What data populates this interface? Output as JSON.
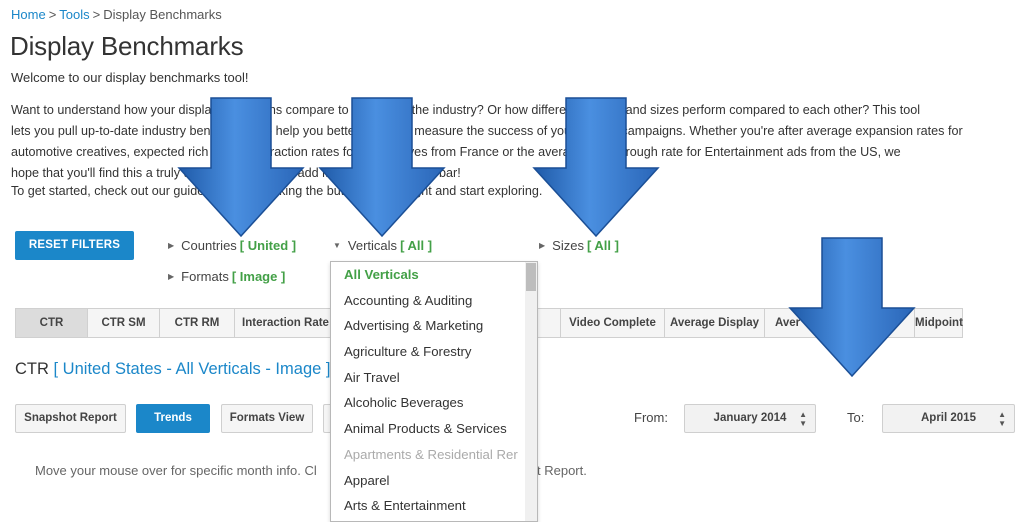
{
  "breadcrumb": {
    "home": "Home",
    "tools": "Tools",
    "current": "Display Benchmarks",
    "separator": ">"
  },
  "page": {
    "title": "Display Benchmarks",
    "welcome": "Welcome to our display benchmarks tool!",
    "intro_lines": [
      "Want to understand how your display campaigns compare to the rest of the industry? Or how different formats and sizes perform compared to each other? This tool",
      "lets you pull up-to-date industry benchmarks to help you better plan and measure the success of your display campaigns. Whether you're after average expansion rates for",
      "automotive creatives, expected rich media interaction rates for all creatives from France or the average click through rate for Entertainment ads from the US, we",
      "hope that you'll find this a truly useful resource and add it to your bookmarks bar!"
    ],
    "get_started": "To get started, check out our guide below by clicking the button to your right and start exploring."
  },
  "filters": {
    "reset_label": "RESET FILTERS",
    "countries": {
      "label": "Countries",
      "value": "[ United ]"
    },
    "verticals": {
      "label": "Verticals",
      "value": "[ All ]"
    },
    "sizes": {
      "label": "Sizes",
      "value": "[ All ]"
    },
    "formats": {
      "label": "Formats",
      "value": "[ Image ]"
    }
  },
  "metric_tabs": [
    {
      "label": "CTR",
      "active": true
    },
    {
      "label": "CTR SM"
    },
    {
      "label": "CTR RM"
    },
    {
      "label": "Interaction Rate"
    },
    {
      "label": ""
    },
    {
      "label": "Video Complete"
    },
    {
      "label": "Average Display"
    },
    {
      "label": "Aver"
    },
    {
      "label": ""
    },
    {
      "label": "Midpoint"
    }
  ],
  "report": {
    "title_prefix": "CTR",
    "title_link": "[ United States - All Verticals - Image ]",
    "views": {
      "snapshot": "Snapshot Report",
      "trends": "Trends",
      "formats": "Formats View"
    },
    "from_label": "From:",
    "from_value": "January 2014",
    "to_label": "To:",
    "to_value": "April 2015",
    "hint_left": "Move your mouse over for specific month info. Cl",
    "hint_right": "t Report."
  },
  "verticals_dropdown": [
    "All Verticals",
    "Accounting & Auditing",
    "Advertising & Marketing",
    "Agriculture & Forestry",
    "Air Travel",
    "Alcoholic Beverages",
    "Animal Products & Services",
    "Apartments & Residential Rer",
    "Apparel",
    "Arts & Entertainment"
  ],
  "colors": {
    "accent_blue": "#1b87c9",
    "filter_green": "#43a047",
    "arrow_blue": "#2f6fc4"
  },
  "icons": {
    "collapsed": "triangle-right",
    "expanded": "triangle-down",
    "spinner": "up-down-arrows",
    "annotation": "down-arrow"
  }
}
